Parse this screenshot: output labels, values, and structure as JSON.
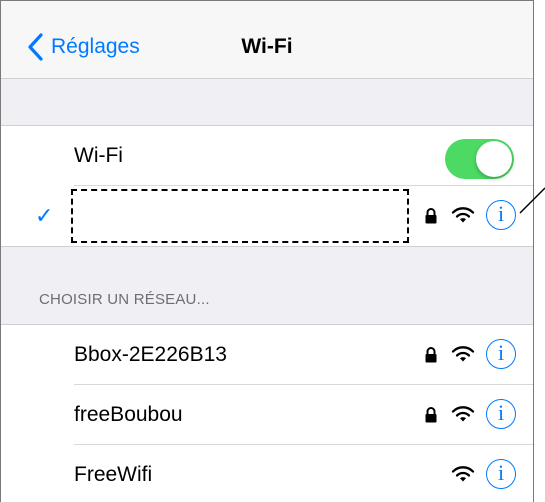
{
  "navbar": {
    "back_label": "Réglages",
    "title": "Wi-Fi"
  },
  "wifi_toggle": {
    "label": "Wi-Fi",
    "state": "on",
    "on_color": "#4cd964"
  },
  "connected_network": {
    "name": "",
    "secured": true,
    "checkmark": "✓"
  },
  "choose_network": {
    "header": "CHOISIR UN RÉSEAU...",
    "networks": [
      {
        "name": "Bbox-2E226B13",
        "secured": true
      },
      {
        "name": "freeBoubou",
        "secured": true
      },
      {
        "name": "FreeWifi",
        "secured": false
      }
    ]
  },
  "info_glyph": "i",
  "colors": {
    "accent": "#007aff",
    "background": "#efeff4"
  }
}
